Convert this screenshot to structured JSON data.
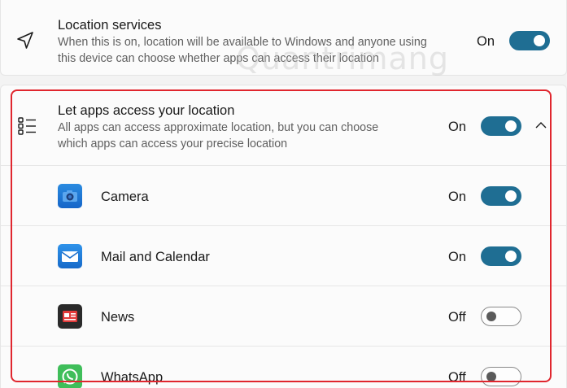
{
  "location_services": {
    "title": "Location services",
    "description_line1": "When this is on, location will be available to Windows and anyone using",
    "description_line2": "this device can choose whether apps can access their location",
    "state": "On",
    "toggle_on": true
  },
  "let_apps": {
    "title": "Let apps access your location",
    "description_line1": "All apps can access approximate location, but you can choose",
    "description_line2": "which apps can access your precise location",
    "state": "On",
    "toggle_on": true
  },
  "apps": [
    {
      "name": "Camera",
      "state": "On",
      "toggle_on": true,
      "icon": "camera-icon"
    },
    {
      "name": "Mail and Calendar",
      "state": "On",
      "toggle_on": true,
      "icon": "mail-icon"
    },
    {
      "name": "News",
      "state": "Off",
      "toggle_on": false,
      "icon": "news-icon"
    },
    {
      "name": "WhatsApp",
      "state": "Off",
      "toggle_on": false,
      "icon": "whatsapp-icon"
    }
  ],
  "watermark": "Quantrimang",
  "colors": {
    "accent": "#1f6e93",
    "highlight": "#e0262e",
    "background": "#f3f3f3",
    "card": "#fbfbfb"
  }
}
